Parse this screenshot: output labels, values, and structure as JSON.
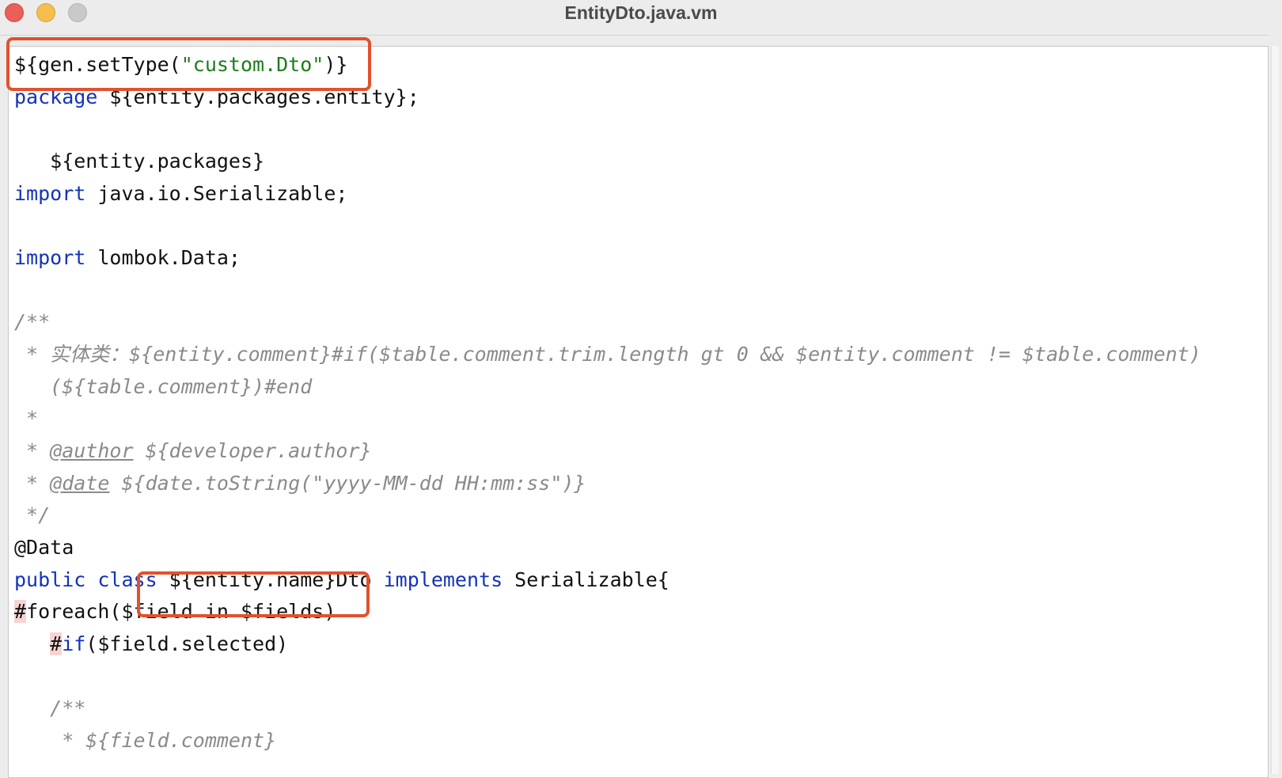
{
  "window": {
    "title": "EntityDto.java.vm"
  },
  "colors": {
    "keyword": "#1432b8",
    "string": "#1b7d1b",
    "comment": "#8a8a8a",
    "highlight_box": "#e2512c",
    "directive_bg": "#f7d4d4"
  },
  "code": {
    "l1_a": "${gen.setType(",
    "l1_str": "\"custom.Dto\"",
    "l1_b": ")}",
    "l2_kw": "package",
    "l2_rest": " ${entity.packages.entity};",
    "l4": "   ${entity.packages}",
    "l5_kw": "import",
    "l5_rest": " java.io.Serializable;",
    "l7_kw": "import",
    "l7_rest": " lombok.Data;",
    "l9": "/**",
    "l10": " * 实体类：${entity.comment}#if($table.comment.trim.length gt 0 && $entity.comment != $table.comment)",
    "l11": "   (${table.comment})#end",
    "l12": " *",
    "l13_a": " * ",
    "l13_tag": "@author",
    "l13_b": " ${developer.author}",
    "l14_a": " * ",
    "l14_tag": "@date",
    "l14_b": " ${date.toString(\"yyyy-MM-dd HH:mm:ss\")}",
    "l15": " */",
    "l16": "@Data",
    "l17_kw1": "public class",
    "l17_mid": " ${entity.name}Dto ",
    "l17_kw2": "implements",
    "l17_rest": " Serializable{",
    "l18_hash": "#",
    "l18_rest": "foreach($field in $fields)",
    "l19_indent": "   ",
    "l19_hash": "#",
    "l19_kw": "if",
    "l19_rest": "($field.selected)",
    "l21": "   /**",
    "l22": "    * ${field.comment}"
  }
}
